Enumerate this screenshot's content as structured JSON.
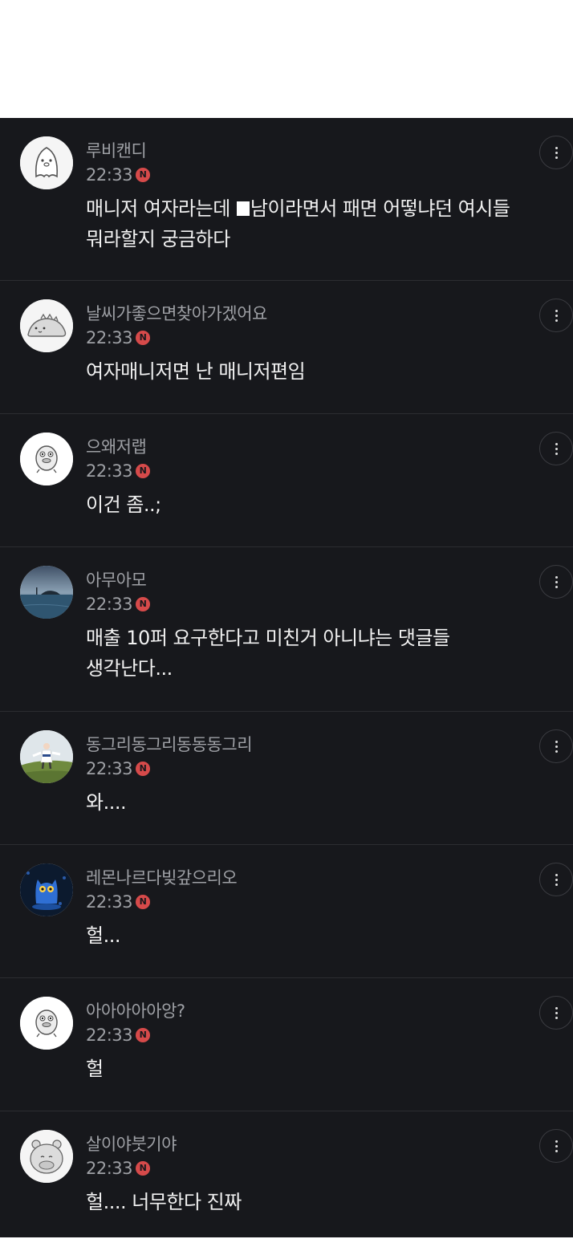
{
  "comments": [
    {
      "nickname": "루비캔디",
      "time": "22:33",
      "badge": "N",
      "text_before": "매니저 여자라는데 ",
      "text_after": "남이라면서 패면 어떻냐던 여시들\n뭐라할지 궁금하다",
      "avatar": "ghost-character"
    },
    {
      "nickname": "날씨가좋으면찾아가겠어요",
      "time": "22:33",
      "badge": "N",
      "text": "여자매니저면 난 매니저편임",
      "avatar": "dinosaur-character"
    },
    {
      "nickname": "으왜저랩",
      "time": "22:33",
      "badge": "N",
      "text": "이건 좀..;",
      "avatar": "duck-character"
    },
    {
      "nickname": "아무아모",
      "time": "22:33",
      "badge": "N",
      "text": "매출 10퍼 요구한다고 미친거 아니냐는 댓글들\n생각난다...",
      "avatar": "sea-photo"
    },
    {
      "nickname": "동그리동그리동동동그리",
      "time": "22:33",
      "badge": "N",
      "text": "와....",
      "avatar": "grass-person-photo"
    },
    {
      "nickname": "레몬나르다빚갚으리오",
      "time": "22:33",
      "badge": "N",
      "text": "헐...",
      "avatar": "blue-cat-photo"
    },
    {
      "nickname": "아아아아아앙?",
      "time": "22:33",
      "badge": "N",
      "text": "헐",
      "avatar": "duck-character"
    },
    {
      "nickname": "살이야붓기야",
      "time": "22:33",
      "badge": "N",
      "text": "헐.... 너무한다 진짜",
      "avatar": "hippo-character"
    }
  ],
  "colors": {
    "background": "#17181c",
    "nickname": "#9ea0a5",
    "text": "#f1f1f1",
    "badge": "#d64a4a",
    "divider": "#2c2d31"
  }
}
